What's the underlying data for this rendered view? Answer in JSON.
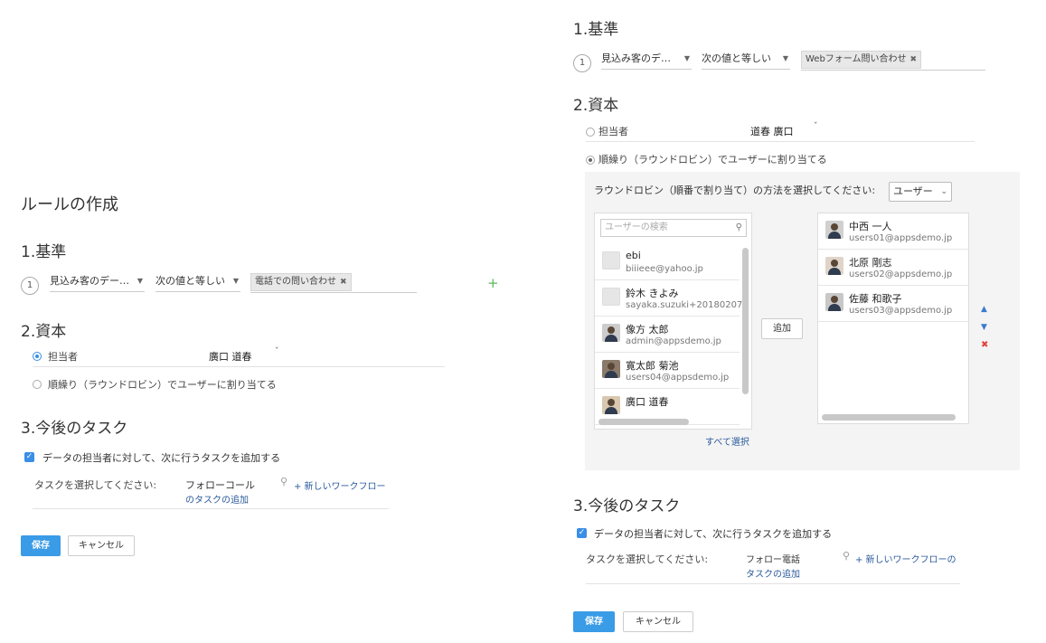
{
  "left": {
    "page_title": "ルールの作成",
    "criteria": {
      "heading": "1.基準",
      "step": "1",
      "field": "見込み客のデー…",
      "operator": "次の値と等しい",
      "value_tag": "電話での問い合わせ",
      "add_symbol": "+"
    },
    "assign": {
      "heading": "2.資本",
      "owner_label": "担当者",
      "owner_value": "廣口 道春",
      "roundrobin_label": "順繰り（ラウンドロビン）でユーザーに割り当てる"
    },
    "tasks": {
      "heading": "3.今後のタスク",
      "checkbox_label": "データの担当者に対して、次に行うタスクを追加する",
      "select_label": "タスクを選択してください:",
      "task_value": "フォローコール",
      "new_workflow": "+ 新しいワークフロー",
      "task_add": "のタスクの追加"
    },
    "save": "保存",
    "cancel": "キャンセル"
  },
  "right": {
    "criteria": {
      "heading": "1.基準",
      "step": "1",
      "field": "見込み客のデ…",
      "operator": "次の値と等しい",
      "value_tag": "Webフォーム問い合わせ"
    },
    "assign": {
      "heading": "2.資本",
      "owner_label": "担当者",
      "owner_value": "道春 廣口",
      "roundrobin_label": "順繰り（ラウンドロビン）でユーザーに割り当てる",
      "method_label": "ラウンドロビン（順番で割り当て）の方法を選択してください:",
      "method_value": "ユーザー",
      "search_placeholder": "ユーザーの検索",
      "available_users": [
        {
          "name": "ebi",
          "email": "biiieee@yahoo.jp"
        },
        {
          "name": "鈴木 きよみ",
          "email": "sayaka.suzuki+20180207"
        },
        {
          "name": "像方 太郎",
          "email": "admin@appsdemo.jp"
        },
        {
          "name": "寛太郎 菊池",
          "email": "users04@appsdemo.jp"
        },
        {
          "name": "廣口 道春",
          "email": ""
        }
      ],
      "select_all": "すべて選択",
      "add_button": "追加",
      "selected_users": [
        {
          "name": "中西 一人",
          "email": "users01@appsdemo.jp"
        },
        {
          "name": "北原 剛志",
          "email": "users02@appsdemo.jp"
        },
        {
          "name": "佐藤 和歌子",
          "email": "users03@appsdemo.jp"
        }
      ]
    },
    "tasks": {
      "heading": "3.今後のタスク",
      "checkbox_label": "データの担当者に対して、次に行うタスクを追加する",
      "select_label": "タスクを選択してください:",
      "task_value": "フォロー電話",
      "new_workflow": "+ 新しいワークフローの",
      "task_add": "タスクの追加"
    },
    "save": "保存",
    "cancel": "キャンセル"
  },
  "colors": {
    "primary": "#3a9be6",
    "link": "#2a5a9c",
    "danger": "#e0443c",
    "add": "#5cb85c"
  }
}
